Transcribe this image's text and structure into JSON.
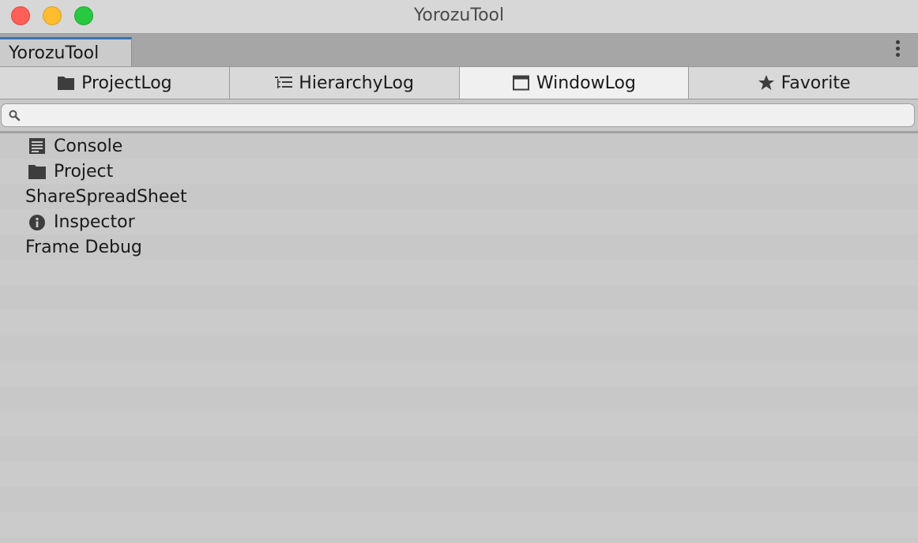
{
  "window": {
    "title": "YorozuTool"
  },
  "dock": {
    "tab_label": "YorozuTool",
    "menu_icon": "kebab-menu-icon"
  },
  "toolbar": {
    "tabs": [
      {
        "label": "ProjectLog",
        "icon": "folder-icon",
        "active": false
      },
      {
        "label": "HierarchyLog",
        "icon": "hierarchy-list-icon",
        "active": false
      },
      {
        "label": "WindowLog",
        "icon": "window-icon",
        "active": true
      },
      {
        "label": "Favorite",
        "icon": "star-icon",
        "active": false
      }
    ]
  },
  "search": {
    "placeholder": "",
    "value": ""
  },
  "list": {
    "items": [
      {
        "label": "Console",
        "icon": "console-icon"
      },
      {
        "label": "Project",
        "icon": "folder-icon"
      },
      {
        "label": "ShareSpreadSheet",
        "icon": ""
      },
      {
        "label": "Inspector",
        "icon": "info-icon"
      },
      {
        "label": "Frame Debug",
        "icon": ""
      }
    ]
  },
  "colors": {
    "accent": "#3a72b0",
    "close": "#fe5f57",
    "minimize": "#febc2e",
    "maximize": "#28c840"
  }
}
